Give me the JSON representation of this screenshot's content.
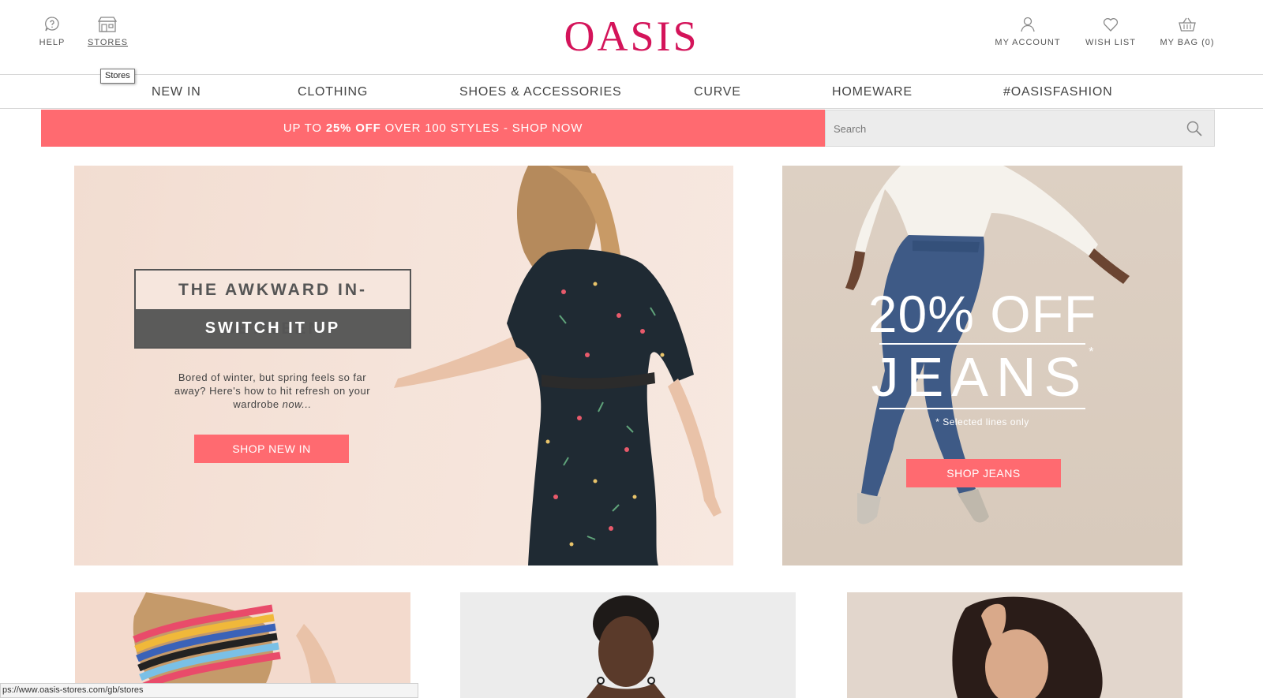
{
  "header": {
    "logo": "OASIS",
    "help_label": "HELP",
    "stores_label": "STORES",
    "stores_tooltip": "Stores",
    "account_label": "MY ACCOUNT",
    "wishlist_label": "WISH LIST",
    "bag_label": "MY BAG (0)"
  },
  "nav": {
    "items": [
      "NEW IN",
      "CLOTHING",
      "SHOES & ACCESSORIES",
      "CURVE",
      "HOMEWARE",
      "#OASISFASHION"
    ]
  },
  "promo": {
    "prefix": "UP TO ",
    "highlight": "25% OFF",
    "suffix": " OVER 100 STYLES - SHOP NOW"
  },
  "search": {
    "placeholder": "Search"
  },
  "hero_left": {
    "headline": "THE AWKWARD IN-BETWEEN",
    "subheadline": "SWITCH IT UP",
    "body": "Bored of winter, but spring feels so far away? Here's how to hit refresh on your wardrobe ",
    "body_italic": "now...",
    "button": "SHOP NEW IN"
  },
  "hero_right": {
    "percent": "20% OFF",
    "title": "JEANS",
    "asterisk": "*",
    "note": "* Selected lines only",
    "button": "SHOP JEANS"
  },
  "status_url": "ps://www.oasis-stores.com/gb/stores",
  "colors": {
    "brand": "#d4145a",
    "accent": "#ff6a70",
    "dark_box": "#5b5b5a"
  }
}
